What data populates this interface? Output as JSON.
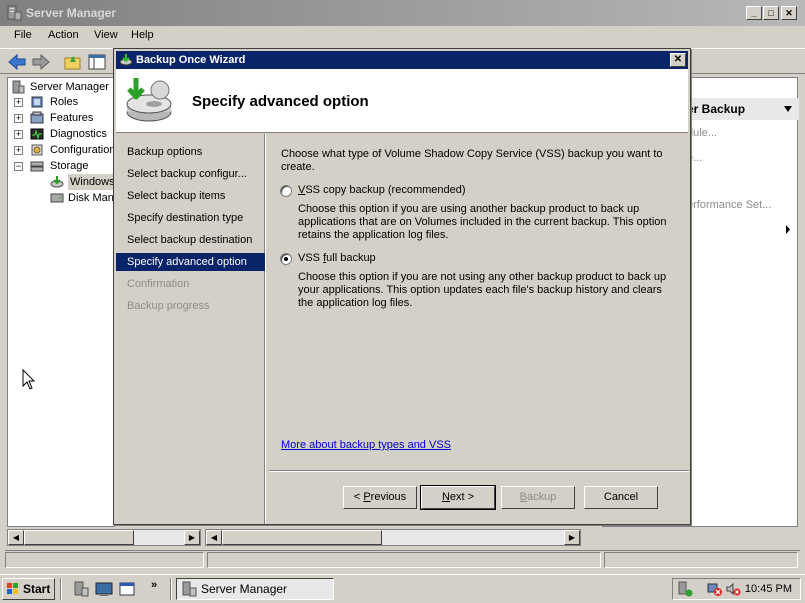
{
  "main_window": {
    "title": "Server Manager",
    "menu": [
      "File",
      "Action",
      "View",
      "Help"
    ]
  },
  "tree": {
    "items": [
      {
        "label": "Server Manager"
      },
      {
        "label": "Roles"
      },
      {
        "label": "Features"
      },
      {
        "label": "Diagnostics"
      },
      {
        "label": "Configuration"
      },
      {
        "label": "Storage"
      },
      {
        "label": "Windows Server Backup"
      },
      {
        "label": "Disk Management"
      }
    ]
  },
  "actions_pane": {
    "header": "er Backup",
    "items": [
      "dule...",
      "e...",
      "erformance Set..."
    ]
  },
  "wizard": {
    "title": "Backup Once Wizard",
    "header_title": "Specify advanced option",
    "nav": [
      {
        "label": "Backup options",
        "state": "normal"
      },
      {
        "label": "Select backup configur...",
        "state": "normal"
      },
      {
        "label": "Select backup items",
        "state": "normal"
      },
      {
        "label": "Specify destination type",
        "state": "normal"
      },
      {
        "label": "Select backup destination",
        "state": "normal"
      },
      {
        "label": "Specify advanced option",
        "state": "active"
      },
      {
        "label": "Confirmation",
        "state": "disabled"
      },
      {
        "label": "Backup progress",
        "state": "disabled"
      }
    ],
    "prompt": "Choose what type of Volume Shadow Copy Service (VSS) backup you want to create.",
    "options": [
      {
        "label_first": "V",
        "label_rest": "SS copy backup (recommended)",
        "description": "Choose this option if you are using another backup product to back up applications that are on Volumes included in the current backup. This option retains the application log files.",
        "selected": false
      },
      {
        "label_pre": "VSS ",
        "label_first": "f",
        "label_rest": "ull backup",
        "description": "Choose this option if you are not using any other backup product to back up your applications. This option updates each file's backup history and clears the application log files.",
        "selected": true
      }
    ],
    "link": "More about backup types and VSS",
    "buttons": {
      "previous_prefix": "< ",
      "previous_first": "P",
      "previous_rest": "revious",
      "next_first": "N",
      "next_rest": "ext >",
      "backup_first": "B",
      "backup_rest": "ackup",
      "cancel": "Cancel"
    }
  },
  "taskbar": {
    "start": "Start",
    "task": "Server Manager",
    "clock": "10:45 PM"
  },
  "colors": {
    "title_active": "#0a246a",
    "title_inactive": "#808080",
    "face": "#d4d0c8",
    "link": "#0000cc"
  }
}
